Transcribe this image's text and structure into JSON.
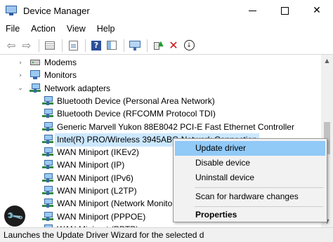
{
  "window": {
    "title": "Device Manager",
    "minimize_glyph": "",
    "maximize_glyph": "",
    "close_glyph": "✕"
  },
  "menu": {
    "items": [
      {
        "label": "File"
      },
      {
        "label": "Action"
      },
      {
        "label": "View"
      },
      {
        "label": "Help"
      }
    ]
  },
  "toolbar": {
    "back_glyph": "⇦",
    "forward_glyph": "⇨",
    "help_glyph": "?",
    "add_glyph": "▲",
    "remove_glyph": "✕",
    "update_glyph": "↓"
  },
  "tree": {
    "expanded_glyph": "⌄",
    "collapsed_glyph": "›",
    "items": [
      {
        "label": "Modems",
        "icon": "modem-icon",
        "expander": "collapsed"
      },
      {
        "label": "Monitors",
        "icon": "monitor-icon",
        "expander": "collapsed"
      },
      {
        "label": "Network adapters",
        "icon": "network-adapter-icon",
        "expander": "expanded"
      },
      {
        "label": "Bluetooth Device (Personal Area Network)",
        "icon": "network-adapter-icon"
      },
      {
        "label": "Bluetooth Device (RFCOMM Protocol TDI)",
        "icon": "network-adapter-icon"
      },
      {
        "label": "Generic Marvell Yukon 88E8042 PCI-E Fast Ethernet Controller",
        "icon": "network-adapter-icon"
      },
      {
        "label": "Intel(R) PRO/Wireless 3945ABG Network Connection",
        "icon": "network-adapter-icon",
        "selected": true
      },
      {
        "label": "WAN Miniport (IKEv2)",
        "icon": "network-adapter-icon"
      },
      {
        "label": "WAN Miniport (IP)",
        "icon": "network-adapter-icon"
      },
      {
        "label": "WAN Miniport (IPv6)",
        "icon": "network-adapter-icon"
      },
      {
        "label": "WAN Miniport (L2TP)",
        "icon": "network-adapter-icon"
      },
      {
        "label": "WAN Miniport (Network Monitor",
        "icon": "network-adapter-icon"
      },
      {
        "label": "WAN Miniport (PPPOE)",
        "icon": "network-adapter-icon"
      },
      {
        "label": "WAN Miniport (PPTP)",
        "icon": "network-adapter-icon"
      }
    ]
  },
  "scrollbar": {
    "up_glyph": "▲",
    "down_glyph": "▼"
  },
  "context_menu": {
    "items": [
      {
        "label": "Update driver"
      },
      {
        "label": "Disable device"
      },
      {
        "label": "Uninstall device"
      },
      {
        "label": "Scan for hardware changes"
      },
      {
        "label": "Properties"
      }
    ]
  },
  "status": {
    "text": "Launches the Update Driver Wizard for the selected d"
  },
  "watermark": {
    "glyph": "🔧"
  }
}
